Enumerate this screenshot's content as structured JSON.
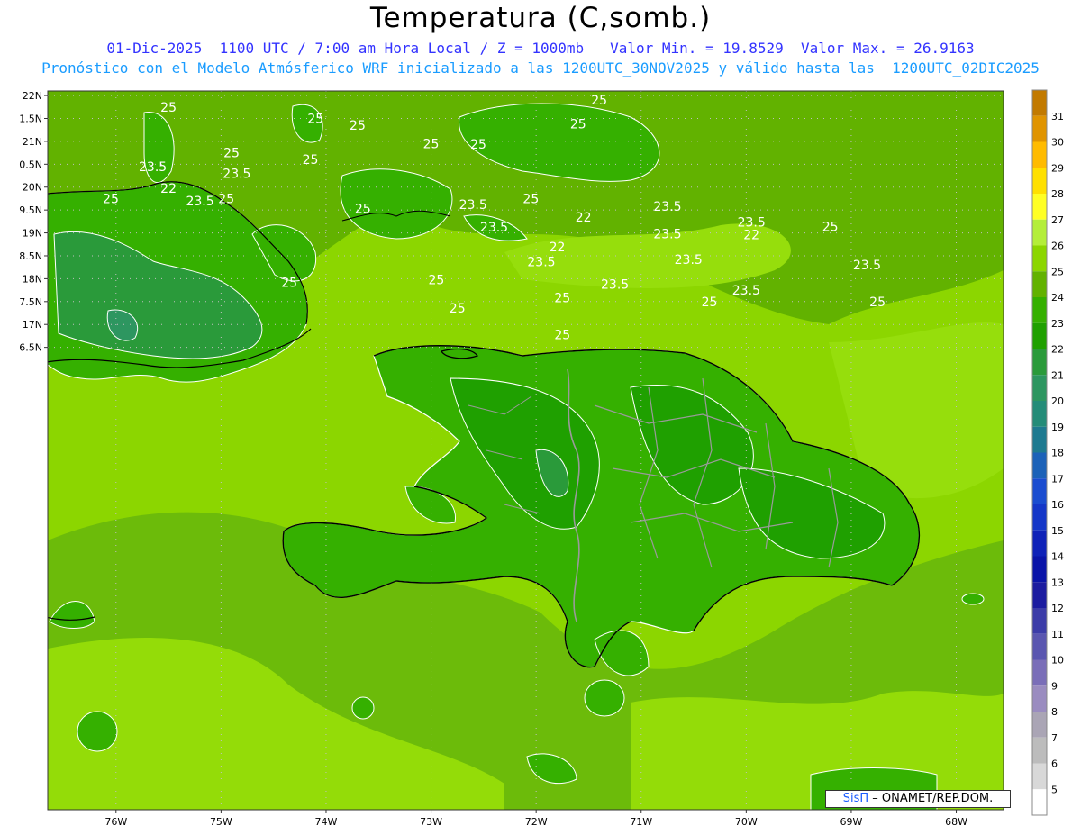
{
  "header": {
    "title": "Temperatura (C,somb.)",
    "subtitle1": "01-Dic-2025  1100 UTC / 7:00 am Hora Local / Z = 1000mb   Valor Min. = 19.8529  Valor Max. = 26.9163",
    "subtitle2": "Pronóstico con el Modelo Atmósferico WRF inicializado a las 1200UTC_30NOV2025 y válido hasta las  1200UTC_02DIC2025"
  },
  "map": {
    "lon_range": [
      -76.65,
      -67.55
    ],
    "lat_range": [
      6.4,
      22.1
    ],
    "lon_ticks": [
      "76W",
      "75W",
      "74W",
      "73W",
      "72W",
      "71W",
      "70W",
      "69W",
      "68W"
    ],
    "lat_ticks": [
      "22N",
      "1.5N",
      "21N",
      "0.5N",
      "20N",
      "9.5N",
      "19N",
      "8.5N",
      "18N",
      "7.5N",
      "17N",
      "6.5N"
    ],
    "contour_labels": [
      {
        "text": "25",
        "lon": -75.5,
        "lat": 21.75
      },
      {
        "text": "25",
        "lon": -74.1,
        "lat": 21.5
      },
      {
        "text": "25",
        "lon": -71.4,
        "lat": 21.9
      },
      {
        "text": "25",
        "lon": -73.7,
        "lat": 21.35
      },
      {
        "text": "25",
        "lon": -71.6,
        "lat": 21.38
      },
      {
        "text": "25",
        "lon": -73.0,
        "lat": 20.95
      },
      {
        "text": "25",
        "lon": -72.55,
        "lat": 20.94
      },
      {
        "text": "25",
        "lon": -74.9,
        "lat": 20.75
      },
      {
        "text": "25",
        "lon": -74.15,
        "lat": 20.6
      },
      {
        "text": "23.5",
        "lon": -75.65,
        "lat": 20.45
      },
      {
        "text": "23.5",
        "lon": -74.85,
        "lat": 20.3
      },
      {
        "text": "22",
        "lon": -75.5,
        "lat": 19.98
      },
      {
        "text": "25",
        "lon": -76.05,
        "lat": 19.75
      },
      {
        "text": "23.5",
        "lon": -75.2,
        "lat": 19.7
      },
      {
        "text": "25",
        "lon": -74.95,
        "lat": 19.75
      },
      {
        "text": "25",
        "lon": -72.05,
        "lat": 19.75
      },
      {
        "text": "23.5",
        "lon": -72.6,
        "lat": 19.62
      },
      {
        "text": "23.5",
        "lon": -70.75,
        "lat": 19.58
      },
      {
        "text": "25",
        "lon": -73.65,
        "lat": 19.53
      },
      {
        "text": "22",
        "lon": -71.55,
        "lat": 19.35
      },
      {
        "text": "23.5",
        "lon": -69.95,
        "lat": 19.24
      },
      {
        "text": "25",
        "lon": -69.2,
        "lat": 19.14
      },
      {
        "text": "23.5",
        "lon": -72.4,
        "lat": 19.13
      },
      {
        "text": "23.5",
        "lon": -70.75,
        "lat": 18.98
      },
      {
        "text": "22",
        "lon": -69.95,
        "lat": 18.96
      },
      {
        "text": "22",
        "lon": -71.8,
        "lat": 18.7
      },
      {
        "text": "23.5",
        "lon": -71.95,
        "lat": 18.37
      },
      {
        "text": "23.5",
        "lon": -70.55,
        "lat": 18.42
      },
      {
        "text": "23.5",
        "lon": -68.85,
        "lat": 18.3
      },
      {
        "text": "25",
        "lon": -74.35,
        "lat": 17.92
      },
      {
        "text": "25",
        "lon": -72.95,
        "lat": 17.98
      },
      {
        "text": "23.5",
        "lon": -71.25,
        "lat": 17.88
      },
      {
        "text": "23.5",
        "lon": -70.0,
        "lat": 17.75
      },
      {
        "text": "25",
        "lon": -71.75,
        "lat": 17.58
      },
      {
        "text": "25",
        "lon": -70.35,
        "lat": 17.5
      },
      {
        "text": "25",
        "lon": -72.75,
        "lat": 17.36
      },
      {
        "text": "25",
        "lon": -68.75,
        "lat": 17.5
      },
      {
        "text": "25",
        "lon": -71.75,
        "lat": 16.78
      }
    ]
  },
  "colorbar": {
    "levels": [
      {
        "label": "31",
        "color": "#c27a00"
      },
      {
        "label": "30",
        "color": "#e09400"
      },
      {
        "label": "29",
        "color": "#ffbb00"
      },
      {
        "label": "28",
        "color": "#ffe000"
      },
      {
        "label": "27",
        "color": "#ffff24"
      },
      {
        "label": "26",
        "color": "#b4ee3a"
      },
      {
        "label": "25",
        "color": "#8cd600"
      },
      {
        "label": "24",
        "color": "#62b200"
      },
      {
        "label": "23",
        "color": "#35b000"
      },
      {
        "label": "22",
        "color": "#1fa000"
      },
      {
        "label": "21",
        "color": "#2a9a3a"
      },
      {
        "label": "20",
        "color": "#2d9660"
      },
      {
        "label": "19",
        "color": "#248c78"
      },
      {
        "label": "18",
        "color": "#1e7a90"
      },
      {
        "label": "17",
        "color": "#1c62b8"
      },
      {
        "label": "16",
        "color": "#1a4cd0"
      },
      {
        "label": "15",
        "color": "#1436c8"
      },
      {
        "label": "14",
        "color": "#0f22b8"
      },
      {
        "label": "13",
        "color": "#0a14a8"
      },
      {
        "label": "12",
        "color": "#1c1ca0"
      },
      {
        "label": "11",
        "color": "#3c3ca8"
      },
      {
        "label": "10",
        "color": "#5a56b0"
      },
      {
        "label": "9",
        "color": "#7a6eb8"
      },
      {
        "label": "8",
        "color": "#9a8cc0"
      },
      {
        "label": "7",
        "color": "#aaa5b5"
      },
      {
        "label": "6",
        "color": "#bcbcbc"
      },
      {
        "label": "5",
        "color": "#d8d8d8"
      },
      {
        "label": "",
        "color": "#ffffff"
      }
    ]
  },
  "watermark": {
    "brand": "SisΠ",
    "rest": " – ONAMET/REP.DOM."
  }
}
